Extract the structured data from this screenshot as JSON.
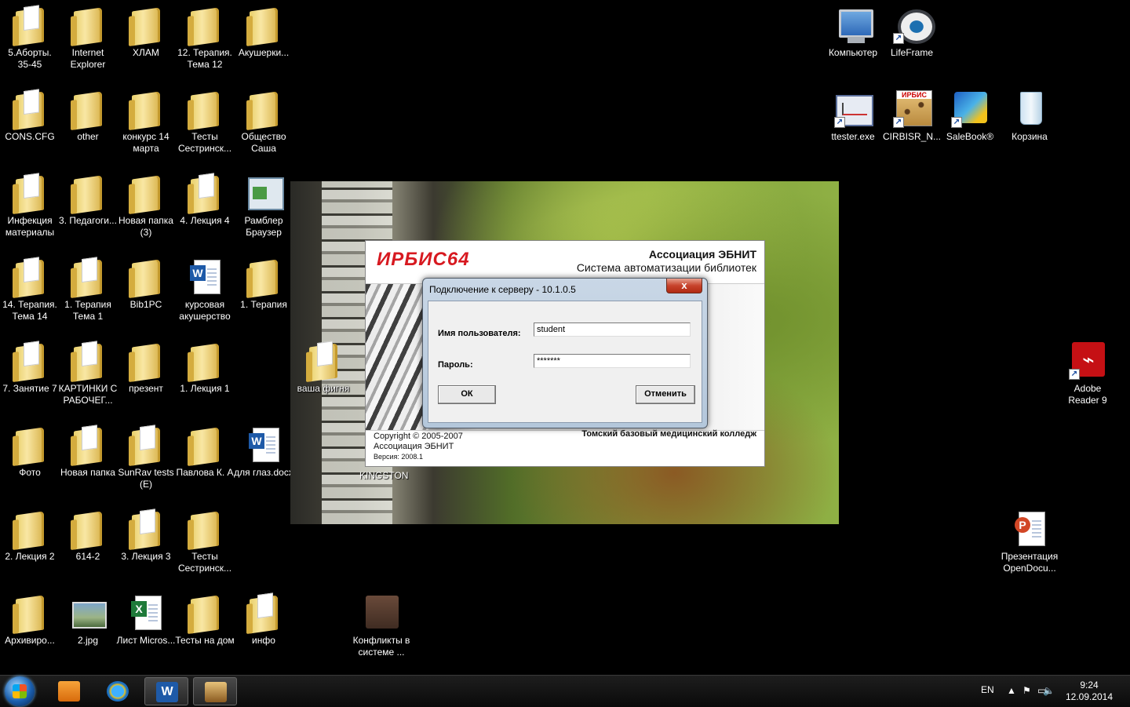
{
  "desktop": {
    "icons": [
      {
        "label": "5.Аборты. 35-45"
      },
      {
        "label": "Internet Explorer"
      },
      {
        "label": "ХЛАМ"
      },
      {
        "label": "12. Терапия. Тема 12"
      },
      {
        "label": "Акушерки..."
      },
      {
        "label": "CONS.CFG"
      },
      {
        "label": "other"
      },
      {
        "label": "конкурс 14 марта"
      },
      {
        "label": "Тесты Сестринск..."
      },
      {
        "label": "Общество Саша"
      },
      {
        "label": "Инфекция материалы"
      },
      {
        "label": "3. Педагоги..."
      },
      {
        "label": "Новая папка (3)"
      },
      {
        "label": "4. Лекция 4"
      },
      {
        "label": "Рамблер Браузер"
      },
      {
        "label": "14. Терапия. Тема 14"
      },
      {
        "label": "1. Терапия Тема 1"
      },
      {
        "label": "Bib1PC"
      },
      {
        "label": "курсовая акушерство"
      },
      {
        "label": "1. Терапия"
      },
      {
        "label": "7. Занятие 7"
      },
      {
        "label": "КАРТИНКИ С РАБОЧЕГ..."
      },
      {
        "label": "презент"
      },
      {
        "label": "1. Лекция 1"
      },
      {
        "label": "Фото"
      },
      {
        "label": "Новая папка"
      },
      {
        "label": "SunRav tests (E)"
      },
      {
        "label": "Павлова К. А"
      },
      {
        "label": "для глаз.docx"
      },
      {
        "label": "2. Лекция 2"
      },
      {
        "label": "614-2"
      },
      {
        "label": "3. Лекция 3"
      },
      {
        "label": "Тесты Сестринск..."
      },
      {
        "label": "Архивиро..."
      },
      {
        "label": "2.jpg"
      },
      {
        "label": "Лист Micros..."
      },
      {
        "label": "Тесты на дом"
      },
      {
        "label": "инфо"
      },
      {
        "label": "Конфликты в системе ..."
      },
      {
        "label": "ваша фигня"
      },
      {
        "label": "Компьютер"
      },
      {
        "label": "LifeFrame"
      },
      {
        "label": "ttester.exe"
      },
      {
        "label": "CIRBISR_N..."
      },
      {
        "label": "SaleBook®"
      },
      {
        "label": "Корзина"
      },
      {
        "label": "Adobe Reader 9"
      },
      {
        "label": "Презентация OpenDocu..."
      }
    ],
    "photo_caption": "KINGSTON"
  },
  "splash": {
    "logo": "ИРБИС64",
    "org_title": "Ассоциация ЭБНИТ",
    "org_subtitle": "Система автоматизации библиотек",
    "copyright": "Copyright © 2005-2007",
    "copyright_org": "Ассоциация ЭБНИТ",
    "version": "Версия: 2008.1",
    "college": "Томский базовый медицинский колледж",
    "logo_badge": "ИРБИС"
  },
  "dialog": {
    "title": "Подключение к серверу - 10.1.0.5",
    "close_glyph": "x",
    "username_label": "Имя пользователя:",
    "username_value": "student",
    "password_label": "Пароль:",
    "password_value": "*******",
    "ok_label": "ОК",
    "cancel_label": "Отменить"
  },
  "taskbar": {
    "language": "EN",
    "time": "9:24",
    "date": "12.09.2014"
  },
  "colors": {
    "accent_red": "#d71920",
    "dialog_frame": "#b4c7db",
    "close_button": "#c7432c"
  }
}
